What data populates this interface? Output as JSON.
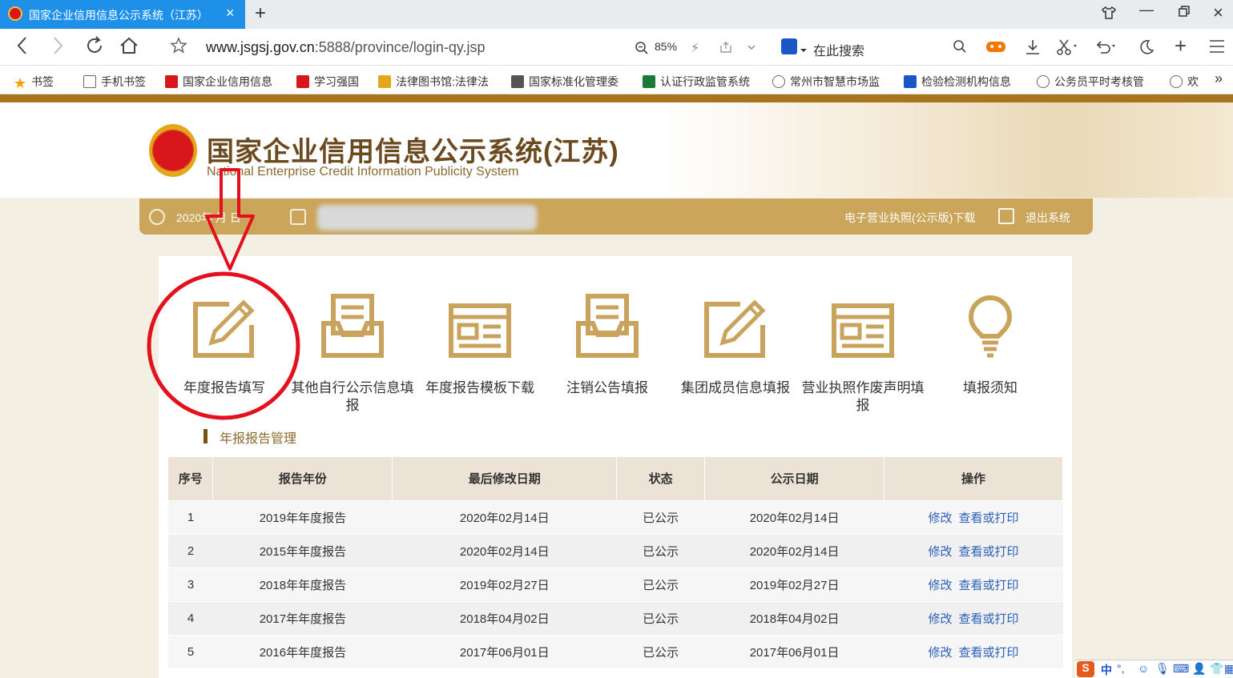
{
  "browser": {
    "tab_title": "国家企业信用信息公示系统（江苏）",
    "tab_close": "×",
    "new_tab": "+",
    "url_host": "www.jsgsj.gov.cn",
    "url_rest": ":5888/province/login-qy.jsp",
    "zoom": "85%",
    "search_placeholder": "在此搜索"
  },
  "bookmarks": [
    {
      "label": "书签",
      "icon": "star-icon",
      "color": "#f5a100"
    },
    {
      "label": "手机书签",
      "icon": "phone-icon",
      "color": "#666666"
    },
    {
      "label": "国家企业信用信息",
      "icon": "emblem-icon",
      "color": "#d7171b"
    },
    {
      "label": "学习强国",
      "icon": "xuexi-icon",
      "color": "#d7171b"
    },
    {
      "label": "法律图书馆:法律法",
      "icon": "law-icon",
      "color": "#e3a71c"
    },
    {
      "label": "国家标准化管理委",
      "icon": "magnifier-icon",
      "color": "#555555"
    },
    {
      "label": "认证行政监管系统",
      "icon": "cert-icon",
      "color": "#1b7a3a"
    },
    {
      "label": "常州市智慧市场监",
      "icon": "globe-icon",
      "color": "#666666"
    },
    {
      "label": "检验检测机构信息",
      "icon": "cert-icon",
      "color": "#1a57c5"
    },
    {
      "label": "公务员平时考核管",
      "icon": "globe-icon",
      "color": "#666666"
    },
    {
      "label": "欢",
      "icon": "globe-icon",
      "color": "#666666"
    }
  ],
  "site": {
    "title": "国家企业信用信息公示系统(江苏)",
    "subtitle": "National Enterprise Credit Information Publicity System"
  },
  "infobar": {
    "date": "2020年 月 日",
    "download": "电子营业执照(公示版)下载",
    "logout": "退出系统"
  },
  "functions": [
    {
      "label": "年度报告填写",
      "icon": "edit-icon"
    },
    {
      "label": "其他自行公示信息填报",
      "icon": "inbox-icon"
    },
    {
      "label": "年度报告模板下载",
      "icon": "template-icon"
    },
    {
      "label": "注销公告填报",
      "icon": "inbox-icon"
    },
    {
      "label": "集团成员信息填报",
      "icon": "edit-icon"
    },
    {
      "label": "营业执照作废声明填报",
      "icon": "template-icon"
    },
    {
      "label": "填报须知",
      "icon": "lightbulb-icon"
    }
  ],
  "section_title": "年报报告管理",
  "table": {
    "headers": [
      "序号",
      "报告年份",
      "最后修改日期",
      "状态",
      "公示日期",
      "操作"
    ],
    "rows": [
      {
        "no": "1",
        "year": "2019年年度报告",
        "modified": "2020年02月14日",
        "status": "已公示",
        "published": "2020年02月14日",
        "edit": "修改",
        "view": "查看或打印"
      },
      {
        "no": "2",
        "year": "2015年年度报告",
        "modified": "2020年02月14日",
        "status": "已公示",
        "published": "2020年02月14日",
        "edit": "修改",
        "view": "查看或打印"
      },
      {
        "no": "3",
        "year": "2018年年度报告",
        "modified": "2019年02月27日",
        "status": "已公示",
        "published": "2019年02月27日",
        "edit": "修改",
        "view": "查看或打印"
      },
      {
        "no": "4",
        "year": "2017年年度报告",
        "modified": "2018年04月02日",
        "status": "已公示",
        "published": "2018年04月02日",
        "edit": "修改",
        "view": "查看或打印"
      },
      {
        "no": "5",
        "year": "2016年年度报告",
        "modified": "2017年06月01日",
        "status": "已公示",
        "published": "2017年06月01日",
        "edit": "修改",
        "view": "查看或打印"
      }
    ]
  },
  "ime": {
    "label": "中"
  },
  "colors": {
    "gold": "#caa55a",
    "brand_brown": "#6b4a1f",
    "annotation_red": "#e3101e",
    "tab_blue": "#1e90e8"
  }
}
